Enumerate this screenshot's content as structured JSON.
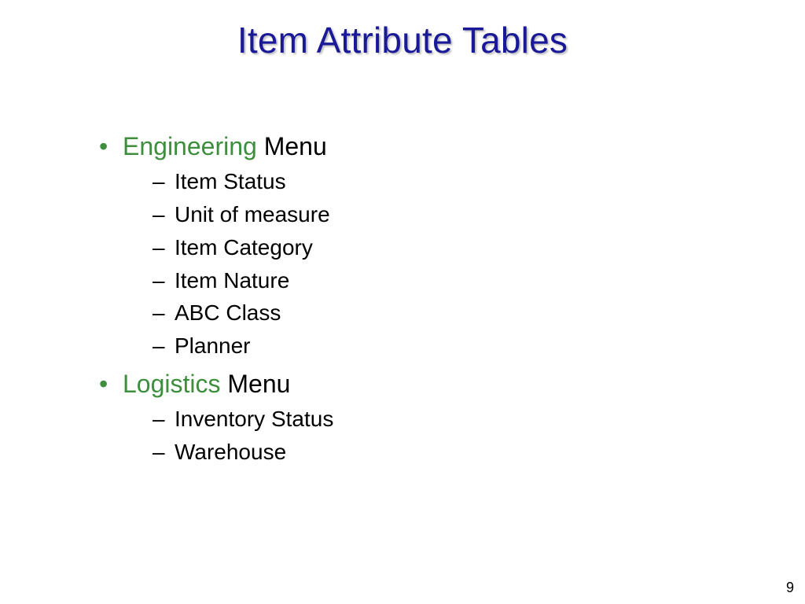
{
  "title": "Item Attribute Tables",
  "menu_word": "Menu",
  "sections": [
    {
      "name": "Engineering",
      "items": [
        "Item Status",
        "Unit of measure",
        "Item Category",
        "Item Nature",
        "ABC Class",
        "Planner"
      ]
    },
    {
      "name": "Logistics",
      "items": [
        "Inventory Status",
        "Warehouse"
      ]
    }
  ],
  "page_number": "9"
}
